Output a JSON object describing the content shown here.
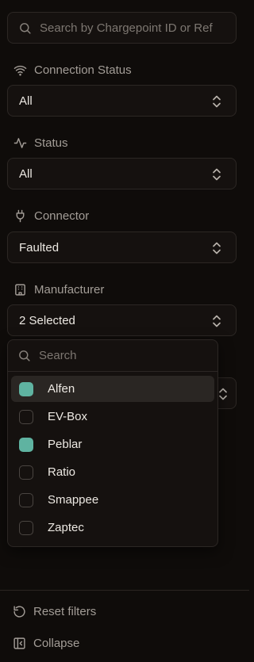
{
  "search": {
    "placeholder": "Search by Chargepoint ID or Ref"
  },
  "filters": {
    "connection_status": {
      "label": "Connection Status",
      "value": "All",
      "icon": "wifi-icon"
    },
    "status": {
      "label": "Status",
      "value": "All",
      "icon": "activity-icon"
    },
    "connector": {
      "label": "Connector",
      "value": "Faulted",
      "icon": "plug-icon"
    },
    "manufacturer": {
      "label": "Manufacturer",
      "value": "2 Selected",
      "icon": "building-icon"
    }
  },
  "dropdown": {
    "search_placeholder": "Search",
    "options": [
      {
        "label": "Alfen",
        "checked": true,
        "highlighted": true
      },
      {
        "label": "EV-Box",
        "checked": false
      },
      {
        "label": "Peblar",
        "checked": true
      },
      {
        "label": "Ratio",
        "checked": false
      },
      {
        "label": "Smappee",
        "checked": false
      },
      {
        "label": "Zaptec",
        "checked": false
      }
    ]
  },
  "footer": {
    "reset_label": "Reset filters",
    "collapse_label": "Collapse"
  },
  "colors": {
    "background": "#0f0c0a",
    "accent": "#5fb3a1",
    "muted_text": "#a39d97"
  }
}
